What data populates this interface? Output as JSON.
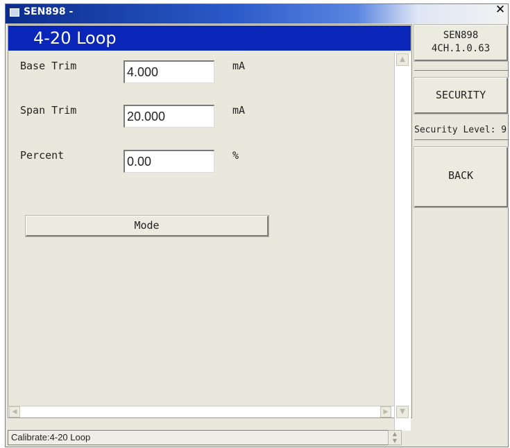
{
  "window": {
    "title": "SEN898 -",
    "close_glyph": "✕"
  },
  "header": {
    "title": "4-20 Loop"
  },
  "fields": [
    {
      "label": "Base Trim",
      "value": "4.000",
      "unit": "mA"
    },
    {
      "label": "Span Trim",
      "value": "20.000",
      "unit": "mA"
    },
    {
      "label": "Percent",
      "value": "0.00",
      "unit": "%"
    }
  ],
  "mode_button": {
    "label": "Mode"
  },
  "side": {
    "device_name": "SEN898",
    "version": "4CH.1.0.63",
    "security_label": "SECURITY",
    "security_level": "Security Level: 9",
    "back_label": "BACK"
  },
  "status": {
    "text": "Calibrate:4-20 Loop"
  },
  "colors": {
    "header_bg": "#0a26b8",
    "window_bg": "#e9e8dc"
  },
  "icons": [
    "app-icon",
    "close-icon",
    "scroll-up-icon",
    "scroll-down-icon",
    "scroll-left-icon",
    "scroll-right-icon"
  ]
}
